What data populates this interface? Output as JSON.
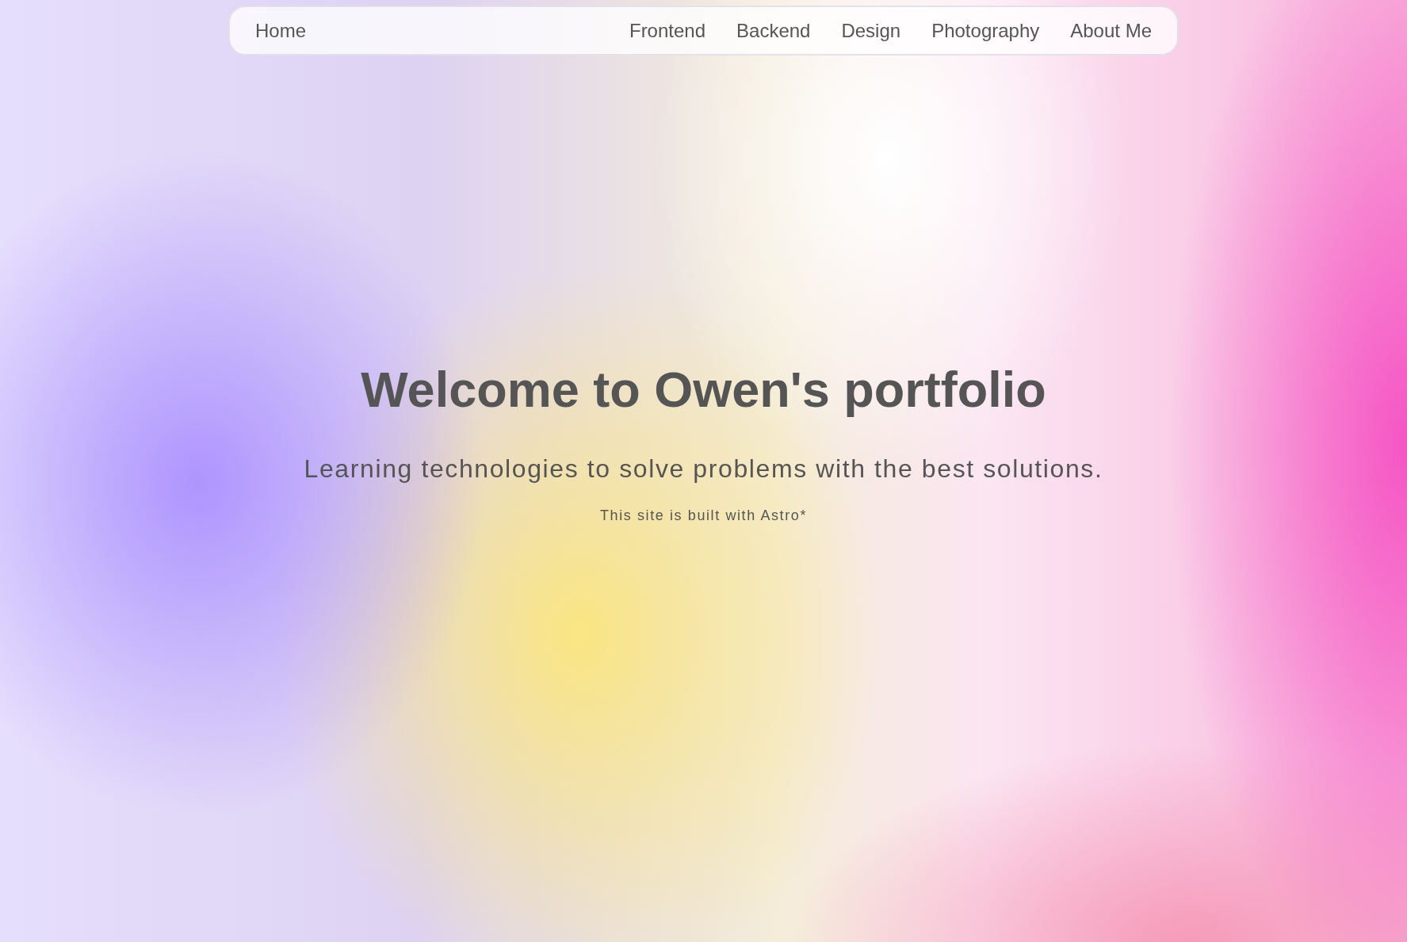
{
  "nav": {
    "home": "Home",
    "links": [
      "Frontend",
      "Backend",
      "Design",
      "Photography",
      "About Me"
    ]
  },
  "hero": {
    "title": "Welcome to Owen's portfolio",
    "subtitle": "Learning technologies to solve problems with the best solutions.",
    "note": "This site is built with Astro*"
  }
}
